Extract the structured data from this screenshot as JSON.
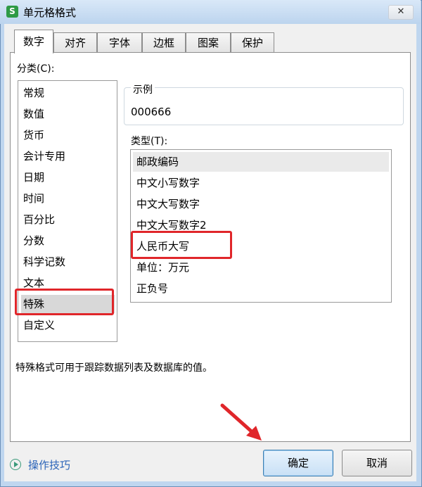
{
  "window": {
    "title": "单元格格式",
    "app_icon": "S",
    "close_glyph": "✕"
  },
  "tabs": [
    {
      "label": "数字",
      "active": true
    },
    {
      "label": "对齐"
    },
    {
      "label": "字体"
    },
    {
      "label": "边框"
    },
    {
      "label": "图案"
    },
    {
      "label": "保护"
    }
  ],
  "category": {
    "label": "分类(C):",
    "items": [
      "常规",
      "数值",
      "货币",
      "会计专用",
      "日期",
      "时间",
      "百分比",
      "分数",
      "科学记数",
      "文本",
      "特殊",
      "自定义"
    ],
    "selected": "特殊"
  },
  "example": {
    "legend": "示例",
    "value": "000666"
  },
  "type": {
    "label": "类型(T):",
    "items": [
      "邮政编码",
      "中文小写数字",
      "中文大写数字",
      "中文大写数字2",
      "人民币大写",
      "单位：万元",
      "正负号"
    ],
    "selected": "邮政编码"
  },
  "description": "特殊格式可用于跟踪数据列表及数据库的值。",
  "footer": {
    "tips_label": "操作技巧",
    "ok_label": "确定",
    "cancel_label": "取消"
  },
  "annotation_color": "#e0262a"
}
